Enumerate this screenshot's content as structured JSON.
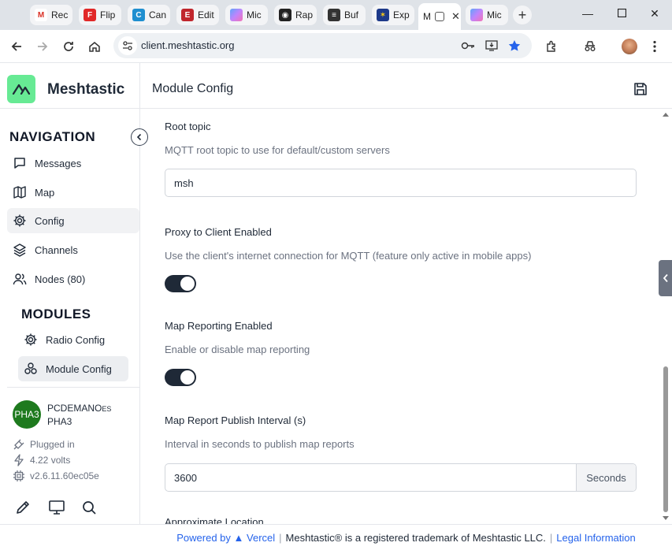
{
  "browser": {
    "tabs": [
      {
        "label": "Rec",
        "icon": "gmail-icon",
        "color": "#ffffff",
        "glyph": "M",
        "glyphColor": "#d93025"
      },
      {
        "label": "Flip",
        "icon": "flipboard-icon",
        "color": "#e12828",
        "glyph": "F",
        "glyphColor": "#ffffff"
      },
      {
        "label": "Can",
        "icon": "canva-icon",
        "color": "#1f8fd0",
        "glyph": "C",
        "glyphColor": "#ffffff"
      },
      {
        "label": "Edit",
        "icon": "edit-icon",
        "color": "#c0262d",
        "glyph": "E",
        "glyphColor": "#ffffff"
      },
      {
        "label": "Mic",
        "icon": "copilot-icon",
        "color": "#8b5cf6",
        "glyph": "●",
        "glyphColor": "#ffffff"
      },
      {
        "label": "Rap",
        "icon": "rapid-icon",
        "color": "#222222",
        "glyph": "◉",
        "glyphColor": "#ffffff"
      },
      {
        "label": "Buf",
        "icon": "buffer-icon",
        "color": "#333333",
        "glyph": "≡",
        "glyphColor": "#ffffff"
      },
      {
        "label": "Exp",
        "icon": "eu-icon",
        "color": "#1e3a8a",
        "glyph": "✶",
        "glyphColor": "#facc15"
      },
      {
        "label": "M",
        "icon": "meshtastic-tab-icon",
        "color": "#ffffff",
        "glyph": "⊞",
        "glyphColor": "#333333"
      },
      {
        "label": "Mic",
        "icon": "copilot-icon",
        "color": "#8b5cf6",
        "glyph": "●",
        "glyphColor": "#ffffff"
      }
    ],
    "url": "client.meshtastic.org"
  },
  "app": {
    "brand": "Meshtastic",
    "header_title": "Module Config",
    "navigation_title": "NAVIGATION",
    "nav_items": [
      {
        "label": "Messages",
        "icon": "message-icon"
      },
      {
        "label": "Map",
        "icon": "map-icon"
      },
      {
        "label": "Config",
        "icon": "gear-icon"
      },
      {
        "label": "Channels",
        "icon": "layers-icon"
      },
      {
        "label": "Nodes (80)",
        "icon": "users-icon"
      }
    ],
    "modules_title": "MODULES",
    "module_items": [
      {
        "label": "Radio Config",
        "icon": "gear-icon"
      },
      {
        "label": "Module Config",
        "icon": "boxes-icon"
      }
    ],
    "device": {
      "avatar_text": "PHA3",
      "name": "PCDEMANO",
      "name_suffix": "ES",
      "short_name": "PHA3",
      "power": "Plugged in",
      "voltage": "4.22 volts",
      "firmware": "v2.6.11.60ec05e"
    },
    "accent": "#67ea94"
  },
  "form": {
    "root_topic": {
      "label": "Root topic",
      "description": "MQTT root topic to use for default/custom servers",
      "value": "msh"
    },
    "proxy": {
      "label": "Proxy to Client Enabled",
      "description": "Use the client's internet connection for MQTT (feature only active in mobile apps)",
      "enabled": true
    },
    "map_reporting": {
      "label": "Map Reporting Enabled",
      "description": "Enable or disable map reporting",
      "enabled": true
    },
    "publish_interval": {
      "label": "Map Report Publish Interval (s)",
      "description": "Interval in seconds to publish map reports",
      "value": "3600",
      "suffix": "Seconds"
    },
    "next_label_partial": "Approximate Location"
  },
  "footer": {
    "powered_by": "Powered by",
    "vercel": "▲ Vercel",
    "trademark": "Meshtastic® is a registered trademark of Meshtastic LLC.",
    "legal": "Legal Information"
  }
}
